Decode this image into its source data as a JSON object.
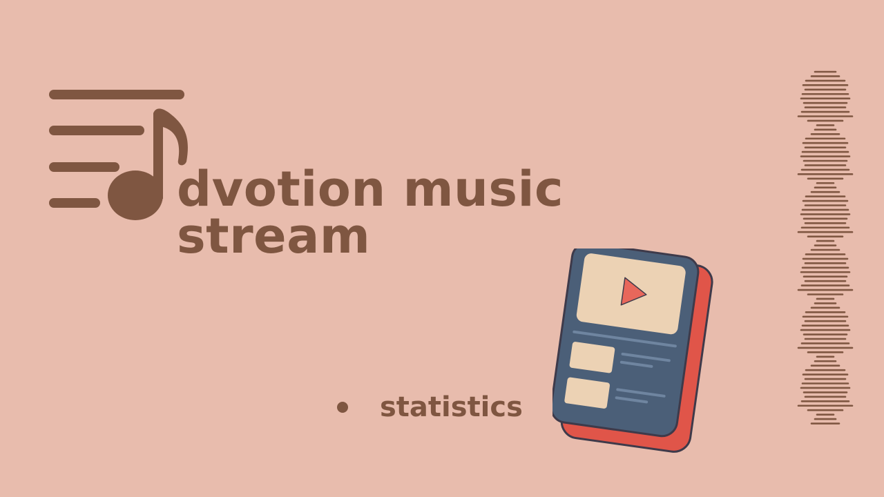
{
  "slide": {
    "title_lines": [
      "dvotion music",
      "stream"
    ],
    "bullets": [
      "statistics"
    ]
  },
  "icons": {
    "logo": "music-playlist-icon",
    "illustration": "music-player-device-icon",
    "decoration": "sound-waveform-icon"
  },
  "colors": {
    "background": "#e8bcad",
    "primary": "#7f5641",
    "device_body": "#4b5f78",
    "device_edge": "#e05549",
    "device_screen": "#ecd2b4",
    "play_button": "#e8675b"
  }
}
